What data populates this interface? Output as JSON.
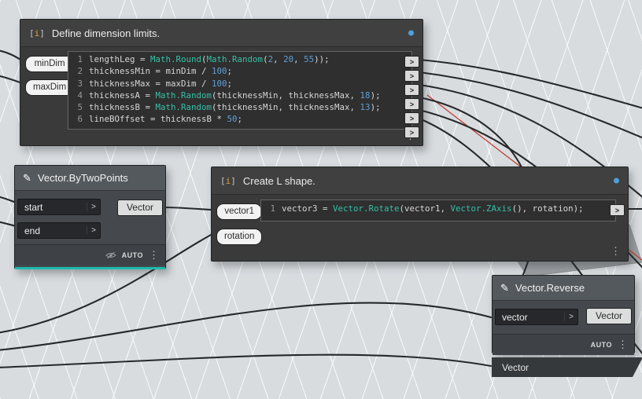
{
  "colors": {
    "canvas_bg": "#d8dcdf",
    "node_dark": "#3a3a3a",
    "node_header_gray": "#54595d",
    "accent_teal": "#1db9ab",
    "port_dot_blue": "#4f9fdb",
    "syntax_function": "#35c0a6",
    "syntax_number": "#5f9fd6",
    "wire": "#26282a",
    "preview_red": "#c23f33"
  },
  "glyphs": {
    "chevron": ">",
    "menu_dots": "⋮",
    "pencil": "✎",
    "code_icon_l": "[",
    "code_icon_m": "i",
    "code_icon_r": "]"
  },
  "nodes": {
    "define": {
      "title": "Define dimension limits.",
      "inputs": [
        "minDim",
        "maxDim"
      ],
      "output_count": 6,
      "code": [
        {
          "num": "1",
          "tokens": [
            {
              "t": "lengthLeg = ",
              "c": "p"
            },
            {
              "t": "Math.Round",
              "c": "f"
            },
            {
              "t": "(",
              "c": "p"
            },
            {
              "t": "Math.Random",
              "c": "f"
            },
            {
              "t": "(",
              "c": "p"
            },
            {
              "t": "2",
              "c": "n"
            },
            {
              "t": ", ",
              "c": "p"
            },
            {
              "t": "20",
              "c": "n"
            },
            {
              "t": ", ",
              "c": "p"
            },
            {
              "t": "55",
              "c": "n"
            },
            {
              "t": "));",
              "c": "p"
            }
          ]
        },
        {
          "num": "2",
          "tokens": [
            {
              "t": "thicknessMin = minDim / ",
              "c": "p"
            },
            {
              "t": "100",
              "c": "n"
            },
            {
              "t": ";",
              "c": "p"
            }
          ]
        },
        {
          "num": "3",
          "tokens": [
            {
              "t": "thicknessMax = maxDim / ",
              "c": "p"
            },
            {
              "t": "100",
              "c": "n"
            },
            {
              "t": ";",
              "c": "p"
            }
          ]
        },
        {
          "num": "4",
          "tokens": [
            {
              "t": "thicknessA = ",
              "c": "p"
            },
            {
              "t": "Math.Random",
              "c": "f"
            },
            {
              "t": "(thicknessMin, thicknessMax, ",
              "c": "p"
            },
            {
              "t": "18",
              "c": "n"
            },
            {
              "t": ");",
              "c": "p"
            }
          ]
        },
        {
          "num": "5",
          "tokens": [
            {
              "t": "thicknessB = ",
              "c": "p"
            },
            {
              "t": "Math.Random",
              "c": "f"
            },
            {
              "t": "(thicknessMin, thicknessMax, ",
              "c": "p"
            },
            {
              "t": "13",
              "c": "n"
            },
            {
              "t": ");",
              "c": "p"
            }
          ]
        },
        {
          "num": "6",
          "tokens": [
            {
              "t": "lineBOffset = thicknessB * ",
              "c": "p"
            },
            {
              "t": "50",
              "c": "n"
            },
            {
              "t": ";",
              "c": "p"
            }
          ]
        }
      ]
    },
    "by_two_points": {
      "title": "Vector.ByTwoPoints",
      "inputs": [
        "start",
        "end"
      ],
      "output": "Vector",
      "footer": "AUTO"
    },
    "l_shape": {
      "title": "Create L shape.",
      "inputs": [
        "vector1",
        "rotation"
      ],
      "output_count": 1,
      "code": [
        {
          "num": "1",
          "tokens": [
            {
              "t": "vector3 = ",
              "c": "p"
            },
            {
              "t": "Vector.Rotate",
              "c": "f"
            },
            {
              "t": "(vector1, ",
              "c": "p"
            },
            {
              "t": "Vector.ZAxis",
              "c": "f"
            },
            {
              "t": "(), rotation);",
              "c": "p"
            }
          ]
        }
      ]
    },
    "reverse": {
      "title": "Vector.Reverse",
      "inputs": [
        "vector"
      ],
      "output": "Vector",
      "footer": "AUTO"
    },
    "vector_bar": {
      "label": "Vector"
    }
  }
}
